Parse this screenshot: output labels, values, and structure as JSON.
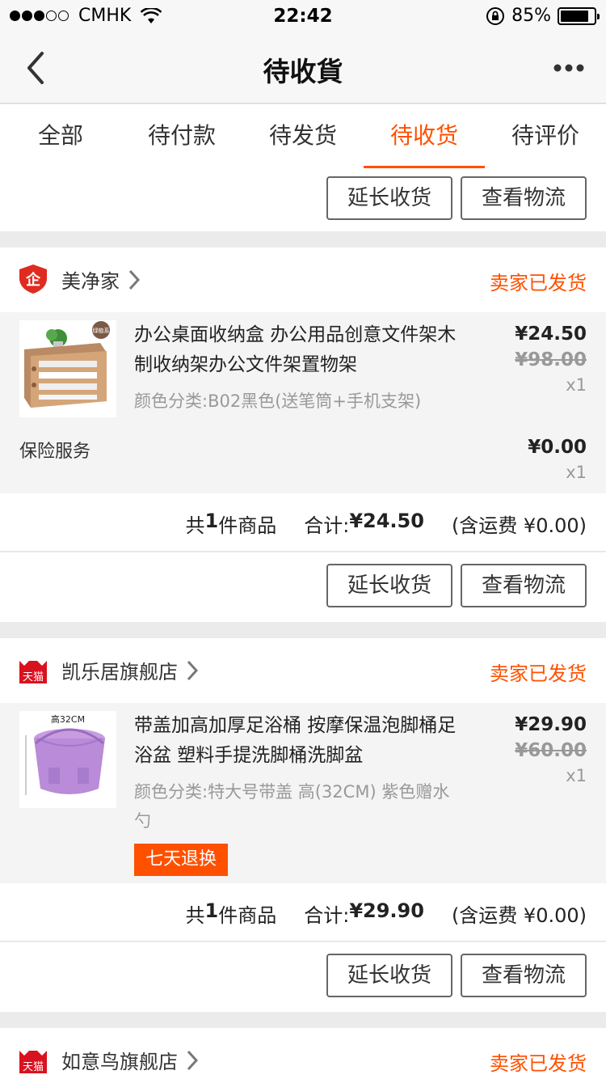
{
  "status_bar": {
    "carrier": "CMHK",
    "time": "22:42",
    "battery": "85%",
    "battery_level": 0.85
  },
  "nav": {
    "title": "待收貨"
  },
  "tabs": [
    {
      "label": "全部",
      "active": false
    },
    {
      "label": "待付款",
      "active": false
    },
    {
      "label": "待发货",
      "active": false
    },
    {
      "label": "待收货",
      "active": true
    },
    {
      "label": "待评价",
      "active": false
    }
  ],
  "buttons": {
    "extend": "延长收货",
    "logistics": "查看物流"
  },
  "orders": [
    {
      "shop_name": "美净家",
      "status": "卖家已发货",
      "item_title": "办公桌面收纳盒 办公用品创意文件架木制收纳架办公文件架置物架",
      "item_sku": "颜色分类:B02黑色(送笔筒+手机支架)",
      "price": "¥24.50",
      "orig_price": "¥98.00",
      "qty": "x1",
      "service_label": "保险服务",
      "service_price": "¥0.00",
      "service_qty": "x1",
      "summary_count_pre": "共",
      "summary_count": "1",
      "summary_count_post": "件商品",
      "summary_total_label": "合计:",
      "summary_total": "¥24.50",
      "summary_ship": "(含运费 ¥0.00)"
    },
    {
      "shop_name": "凯乐居旗舰店",
      "status": "卖家已发货",
      "item_title": "带盖加高加厚足浴桶 按摩保温泡脚桶足浴盆 塑料手提洗脚桶洗脚盆",
      "item_sku": "颜色分类:特大号带盖 高(32CM) 紫色赠水勺",
      "price": "¥29.90",
      "orig_price": "¥60.00",
      "qty": "x1",
      "tag": "七天退换",
      "summary_count_pre": "共",
      "summary_count": "1",
      "summary_count_post": "件商品",
      "summary_total_label": "合计:",
      "summary_total": "¥29.90",
      "summary_ship": "(含运费 ¥0.00)"
    },
    {
      "shop_name": "如意鸟旗舰店",
      "status": "卖家已发货"
    }
  ],
  "thumb_labels": {
    "first": "绿植系",
    "second": "高32CM"
  }
}
